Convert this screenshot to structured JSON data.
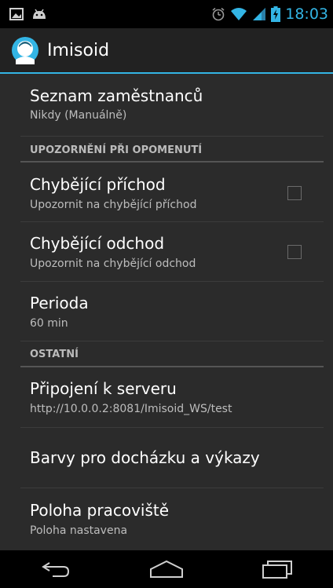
{
  "status_bar": {
    "time": "18:03",
    "icons": [
      "image-notification-icon",
      "android-notification-icon",
      "alarm-icon",
      "wifi-icon",
      "signal-icon",
      "battery-charging-icon"
    ]
  },
  "action_bar": {
    "title": "Imisoid",
    "icon": "app-avatar-icon",
    "accent_color": "#33b5e5"
  },
  "preferences": {
    "employees": {
      "title": "Seznam zaměstnanců",
      "summary": "Nikdy (Manuálně)"
    },
    "category_notifications": "UPOZORNĚNÍ PŘI OPOMENUTÍ",
    "missing_arrival": {
      "title": "Chybějící příchod",
      "summary": "Upozornit na chybějící příchod",
      "checked": false
    },
    "missing_departure": {
      "title": "Chybějící odchod",
      "summary": "Upozornit na chybějící odchod",
      "checked": false
    },
    "period": {
      "title": "Perioda",
      "summary": "60 min"
    },
    "category_other": "OSTATNÍ",
    "server": {
      "title": "Připojení k serveru",
      "summary": "http://10.0.0.2:8081/Imisoid_WS/test"
    },
    "colors": {
      "title": "Barvy pro docházku a výkazy"
    },
    "location": {
      "title": "Poloha pracoviště",
      "summary": "Poloha nastavena"
    }
  },
  "nav_bar": {
    "buttons": [
      "back-icon",
      "home-icon",
      "recent-apps-icon"
    ]
  }
}
